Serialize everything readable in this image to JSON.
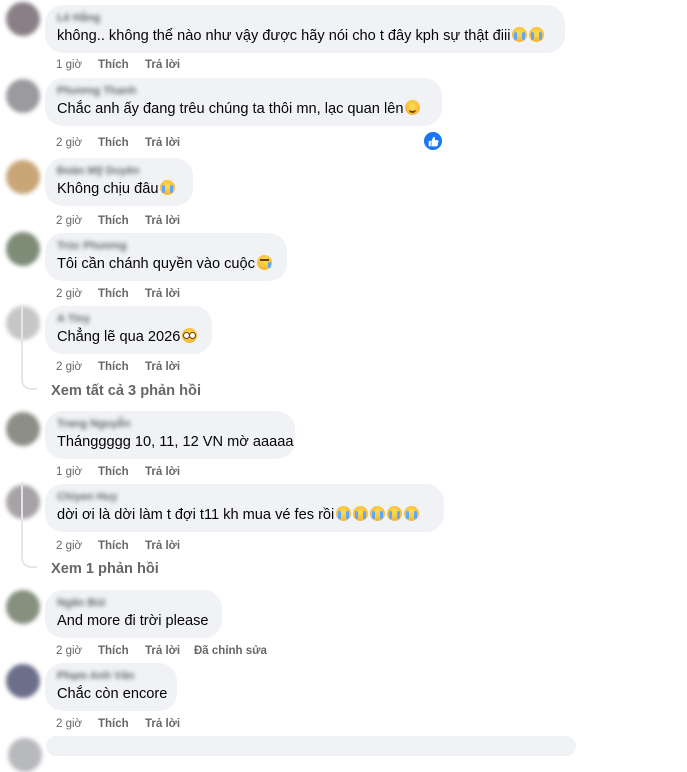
{
  "actions": {
    "like_label": "Thích",
    "reply_label": "Trả lời",
    "edited_label": "Đã chỉnh sửa"
  },
  "comments": [
    {
      "name": "Lê Hằng",
      "time": "1 giờ",
      "text": "không.. không thể nào như vậy được hãy nói cho t đây kph sự thật điii",
      "emojis": [
        "cry",
        "cry"
      ],
      "avatar_color": "#8a7f86"
    },
    {
      "name": "Phương Thanh",
      "time": "2 giờ",
      "text": "Chắc anh ấy đang trêu chúng ta thôi mn, lạc quan lên",
      "emojis": [
        "smile"
      ],
      "avatar_color": "#9b9a9f"
    },
    {
      "name": "Đoàn Mỹ Duyên",
      "time": "2 giờ",
      "text": "Không chịu đâu",
      "emojis": [
        "cry"
      ],
      "avatar_color": "#c9a677"
    },
    {
      "name": "Trúc Phương",
      "time": "2 giờ",
      "text": "Tôi cần chánh quyền vào cuộc",
      "emojis": [
        "tear"
      ],
      "avatar_color": "#7e8c77"
    },
    {
      "name": "A Tiny",
      "time": "2 giờ",
      "text": "Chẳng lẽ qua 2026",
      "emojis": [
        "plead"
      ],
      "avatar_color": "#c6c7c4"
    },
    {
      "name": "Trang Nguyễn",
      "time": "1 giờ",
      "text": "Thánggggg 10, 11, 12 VN mờ aaaaa",
      "emojis": [],
      "avatar_color": "#8d8e88"
    },
    {
      "name": "Chiyen Huy",
      "time": "2 giờ",
      "text": "dời ơi là dời làm t đợi t11 kh mua vé fes rồi",
      "emojis": [
        "cry",
        "cry",
        "cry",
        "cry",
        "cry"
      ],
      "avatar_color": "#a7a2a6"
    },
    {
      "name": "Ngân Bùi",
      "time": "2 giờ",
      "text": "And more đi trời please",
      "emojis": [],
      "avatar_color": "#86907f"
    },
    {
      "name": "Phạm Anh Văn",
      "time": "2 giờ",
      "text": "Chắc còn encore",
      "emojis": [],
      "avatar_color": "#6b6f8a"
    }
  ],
  "view_replies": [
    "Xem tất cả 3 phản hồi",
    "Xem 1 phản hồi"
  ],
  "icons": {
    "like_badge": "thumbs-up-icon"
  }
}
